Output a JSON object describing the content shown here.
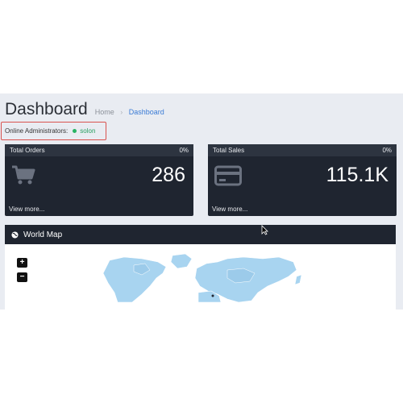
{
  "header": {
    "title": "Dashboard",
    "breadcrumb": {
      "home": "Home",
      "separator": "›",
      "current": "Dashboard"
    }
  },
  "online": {
    "label": "Online Administrators:",
    "user": "solon",
    "status_color": "#28b463"
  },
  "cards": [
    {
      "title": "Total Orders",
      "percent": "0%",
      "value": "286",
      "link": "View more...",
      "icon": "shopping-cart-icon"
    },
    {
      "title": "Total Sales",
      "percent": "0%",
      "value": "115.1K",
      "link": "View more...",
      "icon": "credit-card-icon"
    }
  ],
  "map": {
    "title": "World Map",
    "icon": "globe-icon",
    "zoom_in": "+",
    "zoom_out": "−",
    "land_color": "#a8d4f0"
  },
  "colors": {
    "card_bg": "#1f2530",
    "card_header_bg": "#2d3440",
    "accent_link": "#3a7bd5",
    "highlight_border": "#d9534f"
  }
}
